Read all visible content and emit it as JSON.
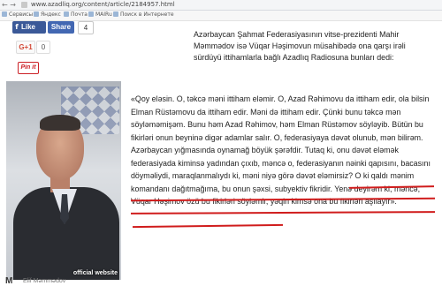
{
  "browser": {
    "nav_glyph": "← →",
    "url": "www.azadliq.org/content/article/2184957.html"
  },
  "bookmarks": [
    {
      "label": "Сервисы"
    },
    {
      "label": "Яндекс"
    },
    {
      "label": "Почта"
    },
    {
      "label": "MAIRu"
    },
    {
      "label": "Поиск в Интернете"
    }
  ],
  "social": {
    "like_label": "Like",
    "share_label": "Share",
    "share_count": "4",
    "gplus_label": "G+1",
    "gplus_count": "0",
    "pin_label": "Pin it"
  },
  "photo": {
    "caption": "official website"
  },
  "footer_partial": {
    "logo": "M",
    "text": "Elif Məmmədov"
  },
  "article": {
    "intro": "Azərbaycan Şahmat Federasiyasının vitse-prezidenti Mahir Məmmədov isə Vüqar Həşimovun müsahibədə ona qarşı irəli sürdüyü ittihamlarla bağlı Azadlıq Radiosuna bunları dedi:",
    "quote": "«Qoy eləsin. O, təkcə məni ittiham eləmir. O, Azad Rəhimovu da ittiham edir, ola bilsin Elman Rüstəmovu da ittiham edir. Məni də ittiham edir. Çünki bunu təkcə mən söyləməmişəm. Bunu həm Azad Rəhimov, həm Elman Rüstəmov söyləyib. Bütün bu fikirləri onun beyninə digər adamlar salır. O, federasiyaya dəvət olunub, mən bilirəm. Azərbaycan yığmasında oynamağ böyük şərəfdir. Tutaq ki, onu dəvət eləmək federasiyada kiminsə yadından çıxıb, məncə o, federasiyanın nəinki qapısını, bacasını döyməliydi, maraqlanmalıydı ki, məni niyə görə dəvət eləmirsiz? O ki qaldı mənim komandanı dağıtmağıma, bu onun şəxsi, subyektiv fikridir. Yenə deyirəm ki, məncə, Vüqar Həşimov özü bu fikirləri söyləmir, yəqin kimsə ona bu fikirləri aşılayır»."
  },
  "colors": {
    "facebook": "#3b5998",
    "underline": "#d01c1c",
    "pin": "#cc2127",
    "gplus": "#d34836"
  }
}
